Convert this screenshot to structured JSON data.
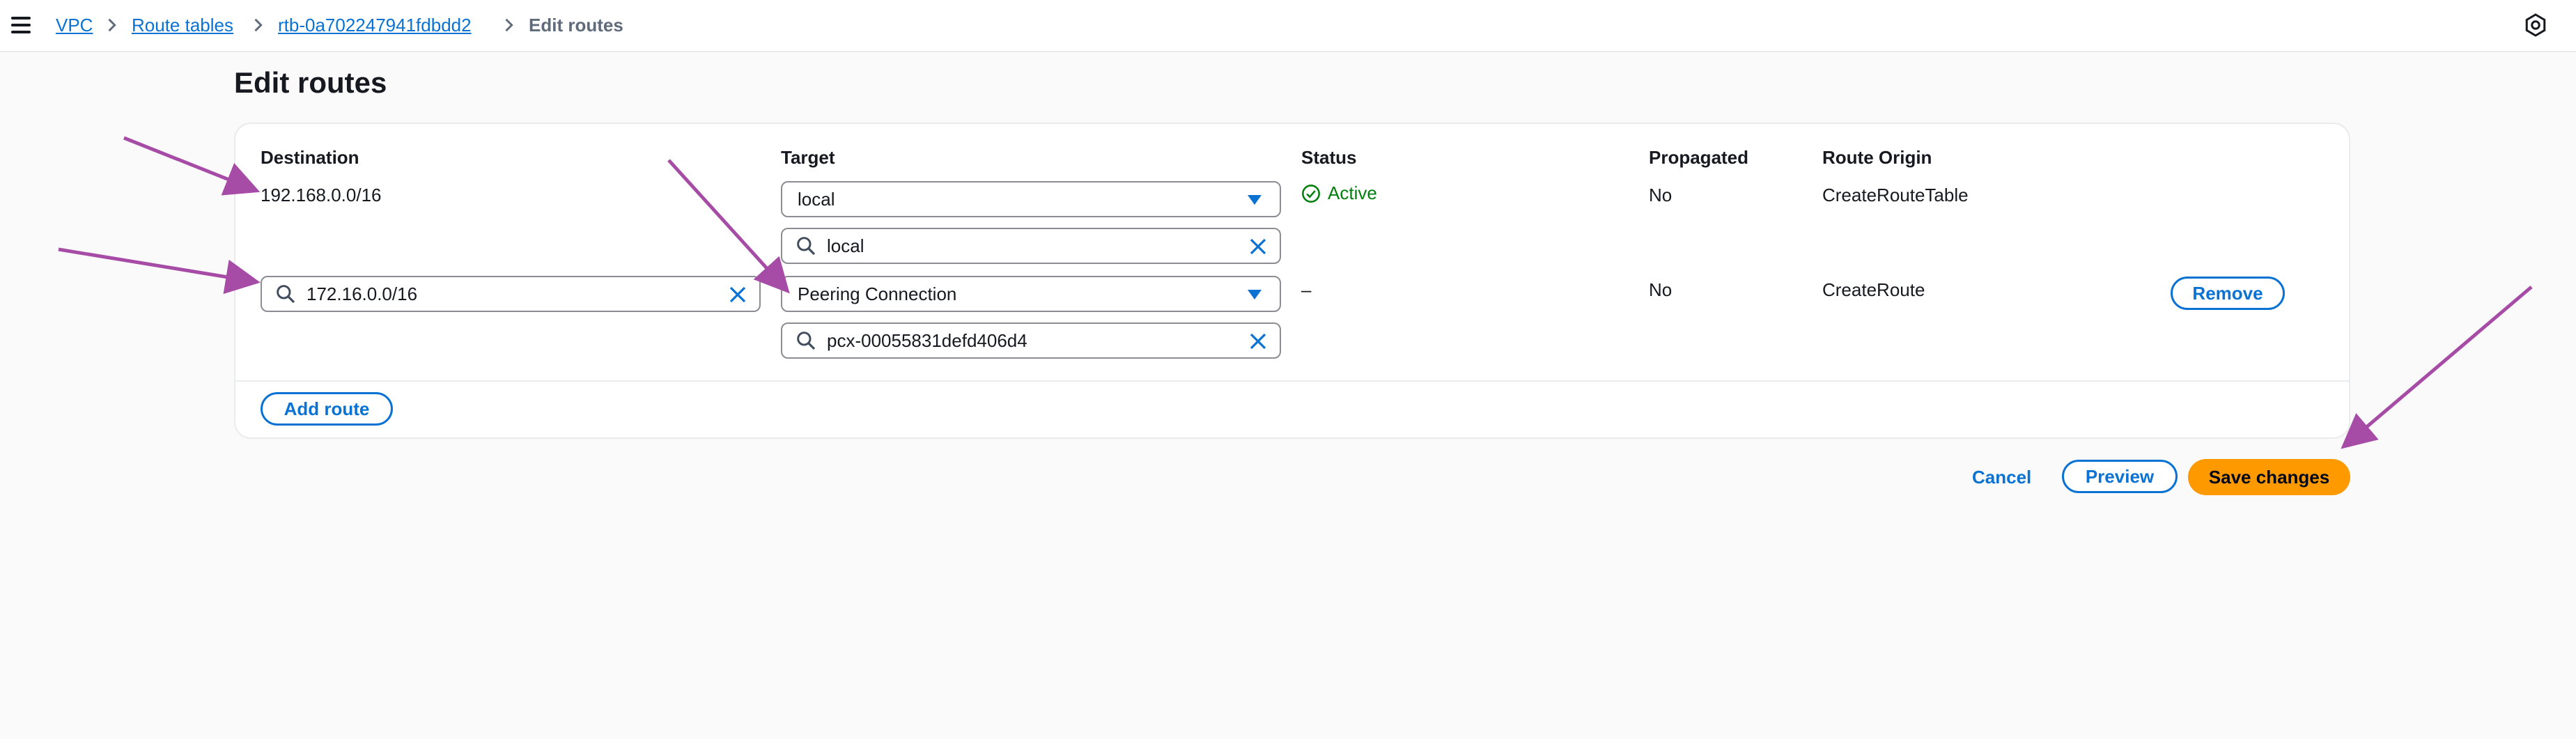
{
  "breadcrumb": {
    "items": [
      "VPC",
      "Route tables",
      "rtb-0a702247941fdbdd2"
    ],
    "current": "Edit routes"
  },
  "page": {
    "title": "Edit routes"
  },
  "table": {
    "columns": [
      "Destination",
      "Target",
      "Status",
      "Propagated",
      "Route Origin"
    ],
    "rows": [
      {
        "destination": "192.168.0.0/16",
        "target_type": "local",
        "target_value": "local",
        "status": "Active",
        "propagated": "No",
        "origin": "CreateRouteTable"
      },
      {
        "destination": "172.16.0.0/16",
        "target_type": "Peering Connection",
        "target_value": "pcx-00055831defd406d4",
        "status": "–",
        "propagated": "No",
        "origin": "CreateRoute",
        "remove_label": "Remove"
      }
    ],
    "add_route_label": "Add route"
  },
  "actions": {
    "cancel": "Cancel",
    "preview": "Preview",
    "save": "Save changes"
  },
  "colors": {
    "link": "#0972d3",
    "primary": "#ff9900",
    "success": "#037f0c",
    "annotation_arrow": "#a64ca6"
  },
  "icons": [
    "menu-icon",
    "chevron-right-icon",
    "settings-icon",
    "search-icon",
    "clear-icon",
    "caret-down-icon",
    "check-circle-icon"
  ]
}
